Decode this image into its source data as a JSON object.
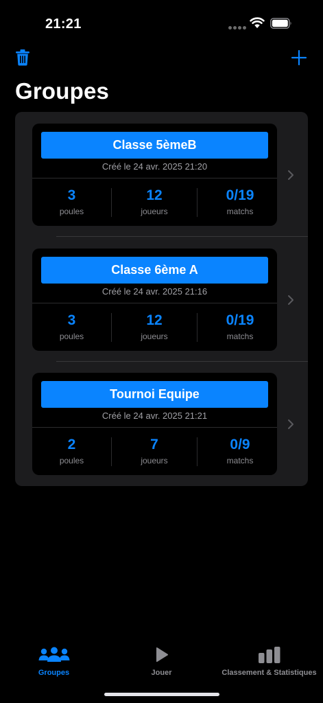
{
  "status_bar": {
    "time": "21:21"
  },
  "nav": {
    "title": "Groupes",
    "delete_icon": "trash-icon",
    "add_icon": "plus-icon"
  },
  "groups": [
    {
      "name": "Classe 5èmeB",
      "created": "Créé le 24 avr. 2025 21:20",
      "stats": [
        {
          "value": "3",
          "label": "poules"
        },
        {
          "value": "12",
          "label": "joueurs"
        },
        {
          "value": "0/19",
          "label": "matchs"
        }
      ]
    },
    {
      "name": "Classe 6ème A",
      "created": "Créé le 24 avr. 2025 21:16",
      "stats": [
        {
          "value": "3",
          "label": "poules"
        },
        {
          "value": "12",
          "label": "joueurs"
        },
        {
          "value": "0/19",
          "label": "matchs"
        }
      ]
    },
    {
      "name": "Tournoi Equipe",
      "created": "Créé le 24 avr. 2025 21:21",
      "stats": [
        {
          "value": "2",
          "label": "poules"
        },
        {
          "value": "7",
          "label": "joueurs"
        },
        {
          "value": "0/9",
          "label": "matchs"
        }
      ]
    }
  ],
  "tabs": [
    {
      "label": "Groupes",
      "icon": "people-icon",
      "active": true
    },
    {
      "label": "Jouer",
      "icon": "play-icon",
      "active": false
    },
    {
      "label": "Classement & Statistiques",
      "icon": "bar-chart-icon",
      "active": false
    }
  ],
  "colors": {
    "accent": "#0a84ff",
    "background": "#000000",
    "grouped_background": "#1c1c1e",
    "secondary_text": "#8e8e93"
  }
}
